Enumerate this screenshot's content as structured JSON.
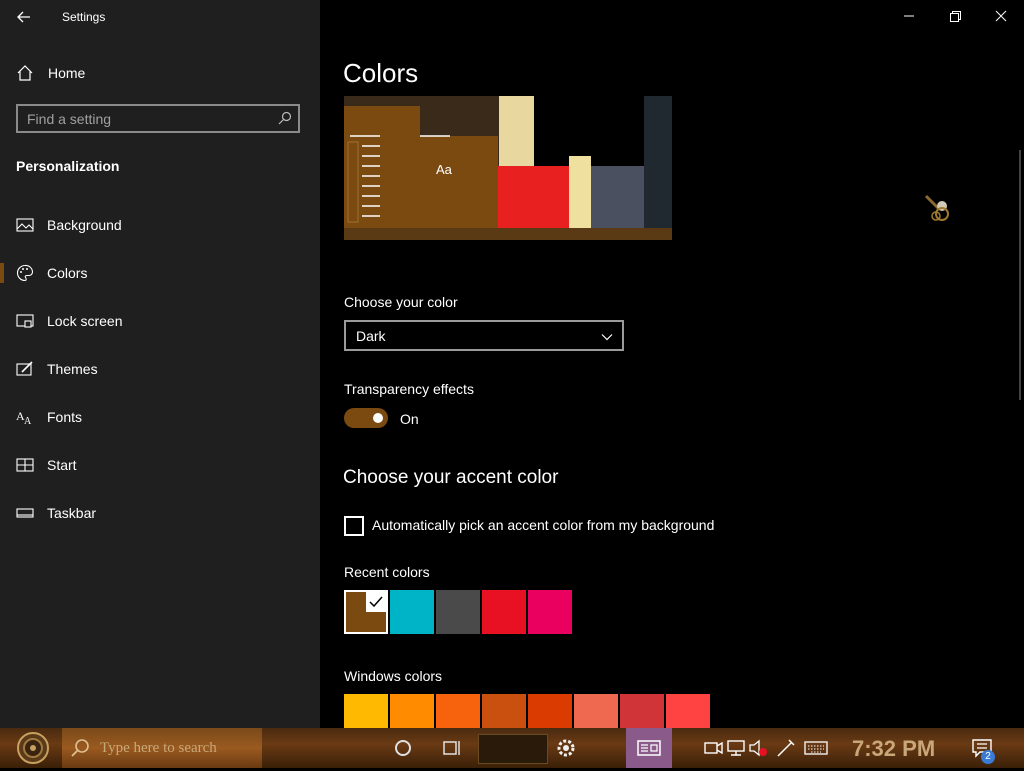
{
  "window": {
    "title": "Settings"
  },
  "sidebar": {
    "home_label": "Home",
    "search_placeholder": "Find a setting",
    "section_title": "Personalization",
    "items": [
      {
        "label": "Background",
        "icon": "picture-icon"
      },
      {
        "label": "Colors",
        "icon": "palette-icon",
        "active": true
      },
      {
        "label": "Lock screen",
        "icon": "lock-screen-icon"
      },
      {
        "label": "Themes",
        "icon": "themes-icon"
      },
      {
        "label": "Fonts",
        "icon": "fonts-icon"
      },
      {
        "label": "Start",
        "icon": "start-icon"
      },
      {
        "label": "Taskbar",
        "icon": "taskbar-icon"
      }
    ]
  },
  "main": {
    "title": "Colors",
    "preview_sample_text": "Aa",
    "choose_color_label": "Choose your color",
    "choose_color_value": "Dark",
    "transparency_label": "Transparency effects",
    "transparency_state": "On",
    "transparency_on": true,
    "accent_heading": "Choose your accent color",
    "auto_accent_label": "Automatically pick an accent color from my background",
    "auto_accent_checked": false,
    "recent_colors_label": "Recent colors",
    "recent_colors": [
      "#7b4a10",
      "#00b4c8",
      "#4a4a4a",
      "#e81123",
      "#ea005e"
    ],
    "selected_recent_index": 0,
    "windows_colors_label": "Windows colors",
    "windows_colors": [
      "#ffb900",
      "#ff8c00",
      "#f7630c",
      "#ca5010",
      "#da3b01",
      "#ef6950",
      "#d13438",
      "#ff4343"
    ]
  },
  "taskbar": {
    "search_placeholder": "Type here to search",
    "clock": "7:32 PM",
    "notification_count": "2"
  }
}
